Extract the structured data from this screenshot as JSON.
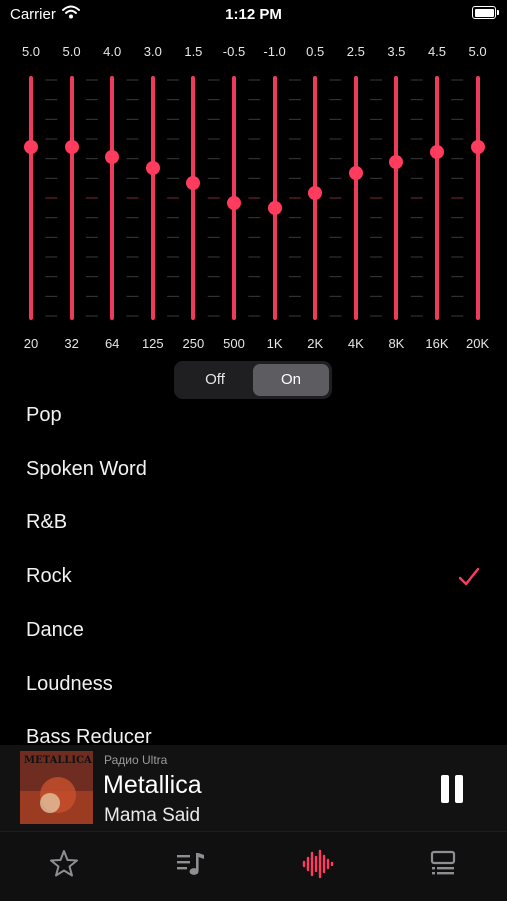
{
  "status_bar": {
    "carrier": "Carrier",
    "time": "1:12 PM",
    "icons": [
      "wifi-icon",
      "battery-icon"
    ]
  },
  "equalizer": {
    "accent_color": "#ff3b5e",
    "value_range": [
      -12,
      12
    ],
    "bands": [
      {
        "freq": "20",
        "value": "5.0"
      },
      {
        "freq": "32",
        "value": "5.0"
      },
      {
        "freq": "64",
        "value": "4.0"
      },
      {
        "freq": "125",
        "value": "3.0"
      },
      {
        "freq": "250",
        "value": "1.5"
      },
      {
        "freq": "500",
        "value": "-0.5"
      },
      {
        "freq": "1K",
        "value": "-1.0"
      },
      {
        "freq": "2K",
        "value": "0.5"
      },
      {
        "freq": "4K",
        "value": "2.5"
      },
      {
        "freq": "8K",
        "value": "3.5"
      },
      {
        "freq": "16K",
        "value": "4.5"
      },
      {
        "freq": "20K",
        "value": "5.0"
      }
    ]
  },
  "toggle": {
    "off_label": "Off",
    "on_label": "On",
    "selected": "On"
  },
  "presets": {
    "items": [
      {
        "label": "Pop",
        "selected": false
      },
      {
        "label": "Spoken Word",
        "selected": false
      },
      {
        "label": "R&B",
        "selected": false
      },
      {
        "label": "Rock",
        "selected": true
      },
      {
        "label": "Dance",
        "selected": false
      },
      {
        "label": "Loudness",
        "selected": false
      },
      {
        "label": "Bass Reducer",
        "selected": false
      }
    ]
  },
  "now_playing": {
    "station": "Радио Ultra",
    "artist": "Metallica",
    "title": "Mama Said",
    "artwork_label": "METALLICA",
    "control_icon": "pause-icon"
  },
  "tab_bar": {
    "tabs": [
      {
        "icon": "star-icon",
        "active": false
      },
      {
        "icon": "playlist-icon",
        "active": false
      },
      {
        "icon": "waveform-icon",
        "active": true
      },
      {
        "icon": "stations-icon",
        "active": false
      }
    ]
  }
}
